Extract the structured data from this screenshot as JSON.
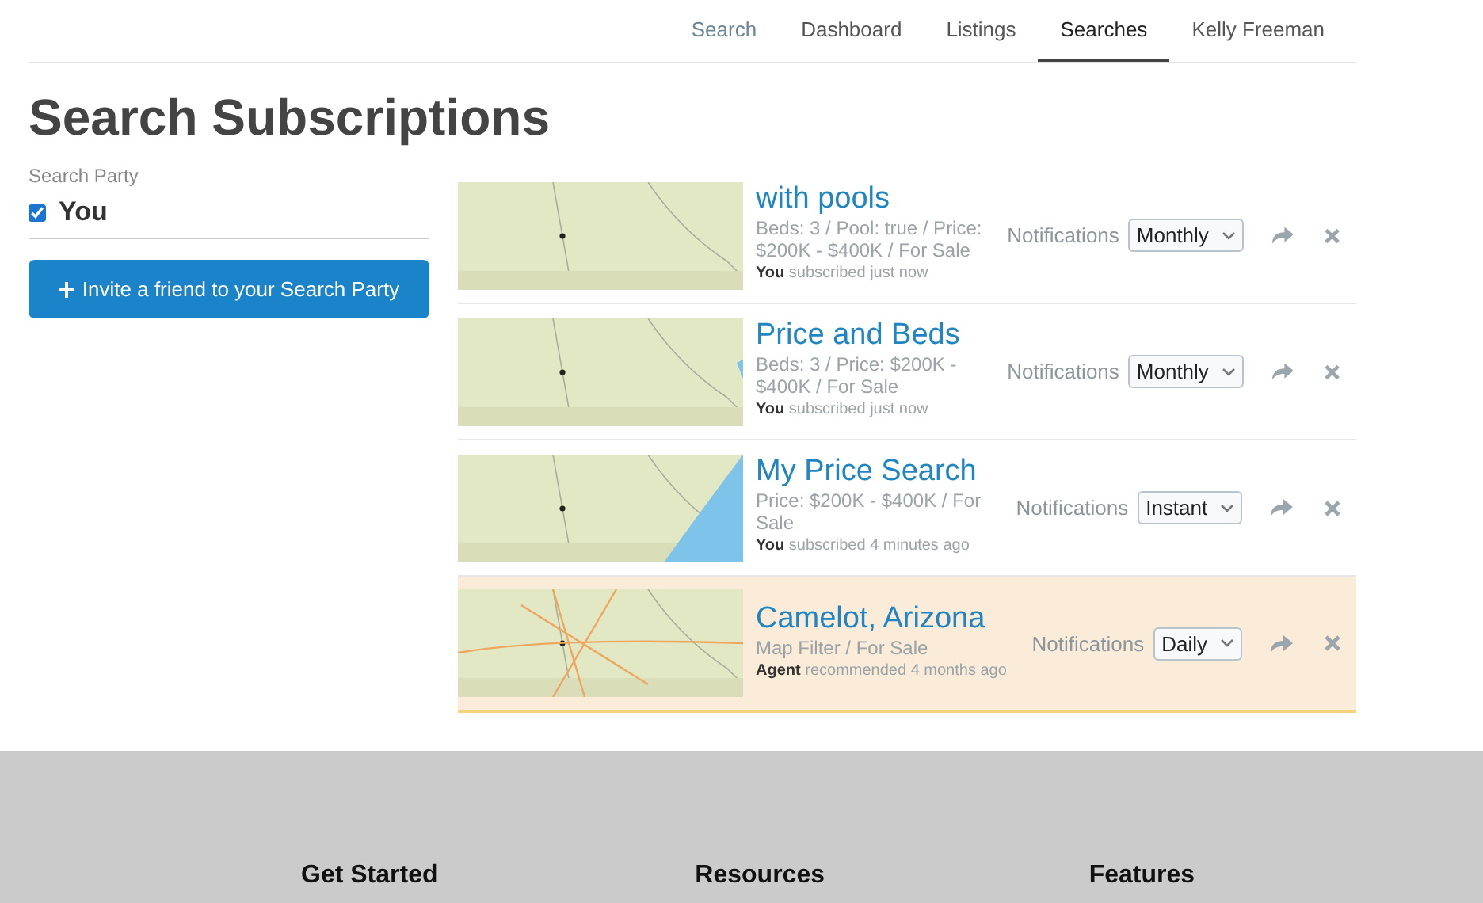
{
  "nav": [
    {
      "label": "Search",
      "selected": false
    },
    {
      "label": "Dashboard",
      "selected": false
    },
    {
      "label": "Listings",
      "selected": false
    },
    {
      "label": "Searches",
      "selected": true
    },
    {
      "label": "Kelly Freeman",
      "selected": false
    }
  ],
  "title": "Search Subscriptions",
  "search_party": {
    "label": "Search Party",
    "members": [
      {
        "name": "You",
        "checked": true
      }
    ],
    "invite_button": "Invite a friend to your Search Party"
  },
  "subscriptions": [
    {
      "name": "with pools",
      "criteria": "Beds: 3 / Pool: true / Price: $200K - $400K / For Sale",
      "actor": "You",
      "activity": "subscribed just now",
      "notifications_label": "Notifications",
      "frequency": "Monthly",
      "highlighted": false
    },
    {
      "name": "Price and Beds",
      "criteria": "Beds: 3 / Price: $200K - $400K / For Sale",
      "actor": "You",
      "activity": "subscribed just now",
      "notifications_label": "Notifications",
      "frequency": "Monthly",
      "highlighted": false
    },
    {
      "name": "My Price Search",
      "criteria": "Price: $200K - $400K / For Sale",
      "actor": "You",
      "activity": "subscribed 4 minutes ago",
      "notifications_label": "Notifications",
      "frequency": "Instant",
      "highlighted": false
    },
    {
      "name": "Camelot, Arizona",
      "criteria": "Map Filter / For Sale",
      "actor": "Agent",
      "activity": "recommended 4 months ago",
      "notifications_label": "Notifications",
      "frequency": "Daily",
      "highlighted": true
    }
  ],
  "footer": {
    "columns": [
      "Get Started",
      "Resources",
      "Features"
    ]
  }
}
